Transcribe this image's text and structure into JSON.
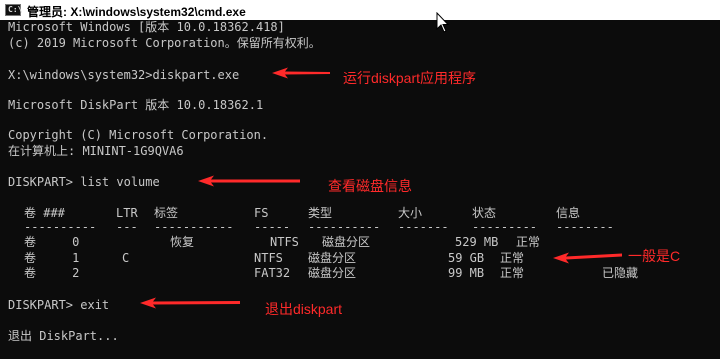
{
  "window": {
    "title": "管理员: X:\\windows\\system32\\cmd.exe",
    "icon_name": "cmd-icon",
    "icon_glyph": "C:\\"
  },
  "console": {
    "banner": [
      "Microsoft Windows [版本 10.0.18362.418]",
      "(c) 2019 Microsoft Corporation。保留所有权利。"
    ],
    "cmd_diskpart": "X:\\windows\\system32>diskpart.exe",
    "diskpart_version": "Microsoft DiskPart 版本 10.0.18362.1",
    "copyright": "Copyright (C) Microsoft Corporation.",
    "computer": "在计算机上: MININT-1G9QVA6",
    "cmd_list_volume": "DISKPART> list volume",
    "table": {
      "headers": [
        "卷 ###",
        "LTR",
        "标签",
        "FS",
        "类型",
        "大小",
        "状态",
        "信息"
      ],
      "separators": [
        "----------",
        "---",
        "-----------",
        "-----",
        "----------",
        "-------",
        "---------",
        "--------"
      ],
      "rows": [
        [
          "卷     0",
          "",
          "恢复",
          "NTFS",
          "磁盘分区",
          "529 MB",
          "正常",
          ""
        ],
        [
          "卷     1",
          "C",
          "",
          "NTFS",
          "磁盘分区",
          "59 GB",
          "正常",
          ""
        ],
        [
          "卷     2",
          "",
          "",
          "FAT32",
          "磁盘分区",
          "99 MB",
          "正常",
          "已隐藏"
        ]
      ]
    },
    "cmd_exit": "DISKPART> exit",
    "exit_message": "退出 DiskPart..."
  },
  "annotations": {
    "color": "#ff2a2a",
    "run_diskpart": "运行diskpart应用程序",
    "view_disk_info": "查看磁盘信息",
    "usually_c": "一般是C",
    "exit_diskpart": "退出diskpart"
  },
  "colors": {
    "background": "#0c0c0c",
    "text": "#c8c8c8",
    "titlebar": "#ffffff"
  }
}
